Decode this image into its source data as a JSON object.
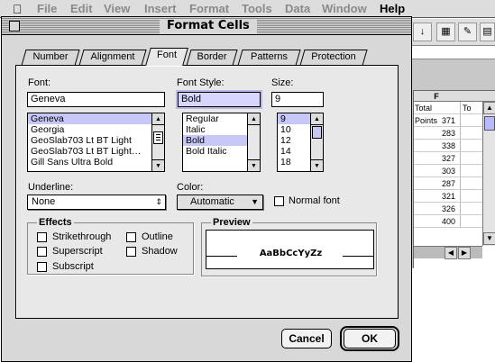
{
  "menubar": {
    "items": [
      "File",
      "Edit",
      "View",
      "Insert",
      "Format",
      "Tools",
      "Data",
      "Window",
      "Help"
    ]
  },
  "spreadsheet": {
    "column_header": "F",
    "column_title": "Total Points",
    "column_title_g": "To",
    "values": [
      "371",
      "283",
      "338",
      "327",
      "303",
      "287",
      "321",
      "326",
      "400"
    ]
  },
  "dialog": {
    "title": "Format Cells",
    "tabs": [
      "Number",
      "Alignment",
      "Font",
      "Border",
      "Patterns",
      "Protection"
    ],
    "selected_tab": "Font",
    "font": {
      "label": "Font:",
      "value": "Geneva",
      "list": [
        "Geneva",
        "Georgia",
        "GeoSlab703 Lt BT Light",
        "GeoSlab703 Lt BT Light…",
        "Gill Sans Ultra Bold"
      ],
      "selected": "Geneva"
    },
    "font_style": {
      "label": "Font Style:",
      "value": "Bold",
      "list": [
        "Regular",
        "Italic",
        "Bold",
        "Bold Italic"
      ],
      "selected": "Bold"
    },
    "size": {
      "label": "Size:",
      "value": "9",
      "list": [
        "9",
        "10",
        "12",
        "14",
        "18"
      ],
      "selected": "9"
    },
    "underline": {
      "label": "Underline:",
      "value": "None"
    },
    "color": {
      "label": "Color:",
      "value": "Automatic"
    },
    "normal_font": {
      "label": "Normal font",
      "checked": false
    },
    "effects": {
      "title": "Effects",
      "options": [
        "Strikethrough",
        "Superscript",
        "Subscript",
        "Outline",
        "Shadow"
      ]
    },
    "preview": {
      "title": "Preview",
      "sample": "AaBbCcYyZz"
    },
    "buttons": {
      "cancel": "Cancel",
      "ok": "OK"
    }
  }
}
